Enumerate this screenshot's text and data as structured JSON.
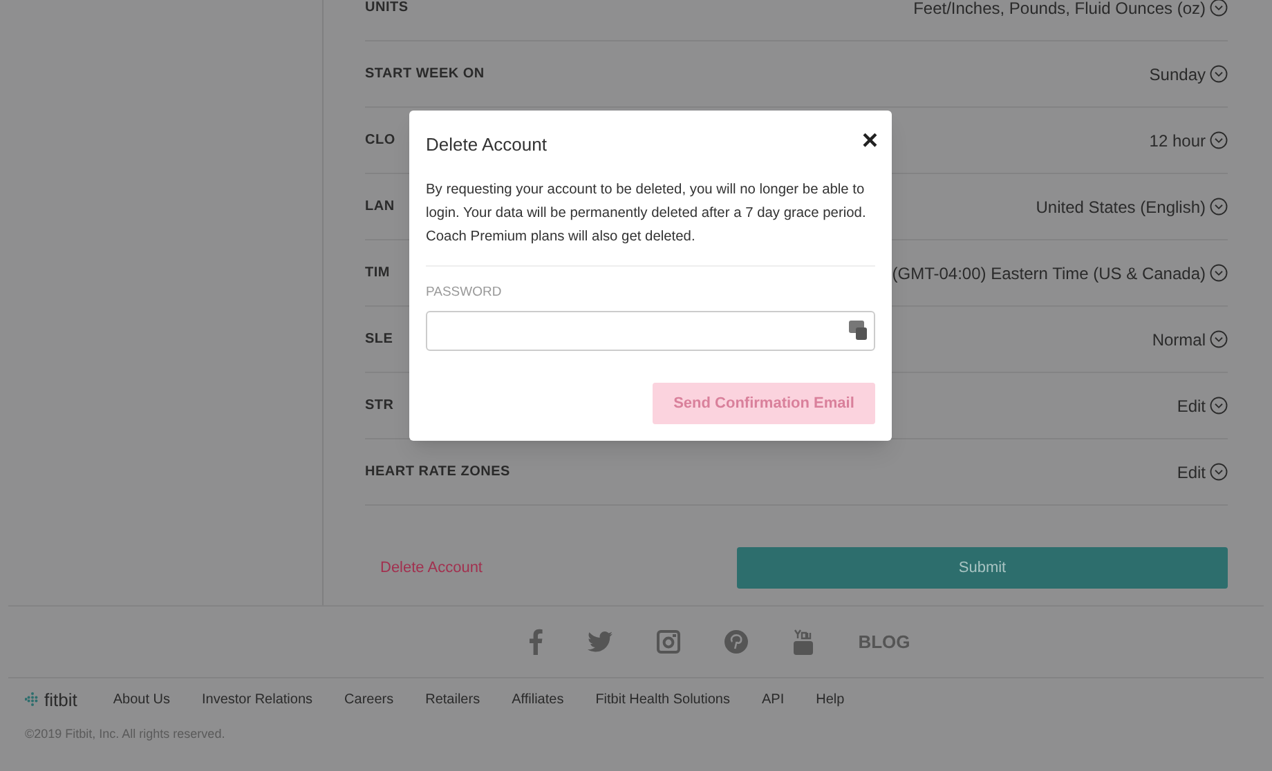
{
  "settings": [
    {
      "label": "UNITS",
      "value": "Feet/Inches, Pounds, Fluid Ounces (oz)"
    },
    {
      "label": "START WEEK ON",
      "value": "Sunday"
    },
    {
      "label": "CLO",
      "value": "12 hour"
    },
    {
      "label": "LAN",
      "value": "United States (English)"
    },
    {
      "label": "TIM",
      "value": "(GMT-04:00) Eastern Time (US & Canada)"
    },
    {
      "label": "SLE",
      "value": "Normal"
    },
    {
      "label": "STR",
      "value": "Edit"
    },
    {
      "label": "HEART RATE ZONES",
      "value": "Edit"
    }
  ],
  "delete_link": "Delete Account",
  "submit": "Submit",
  "social": {
    "blog": "BLOG"
  },
  "footer": {
    "logo": "fitbit",
    "links": [
      "About Us",
      "Investor Relations",
      "Careers",
      "Retailers",
      "Affiliates",
      "Fitbit Health Solutions",
      "API",
      "Help"
    ],
    "copyright": "©2019 Fitbit, Inc. All rights reserved."
  },
  "modal": {
    "title": "Delete Account",
    "close": "×",
    "body": "By requesting your account to be deleted, you will no longer be able to login. Your data will be permanently deleted after a 7 day grace period. Coach Premium plans will also get deleted.",
    "password_label": "PASSWORD",
    "button": {
      "label": "Send Confirmation Email",
      "disabled": true
    }
  }
}
